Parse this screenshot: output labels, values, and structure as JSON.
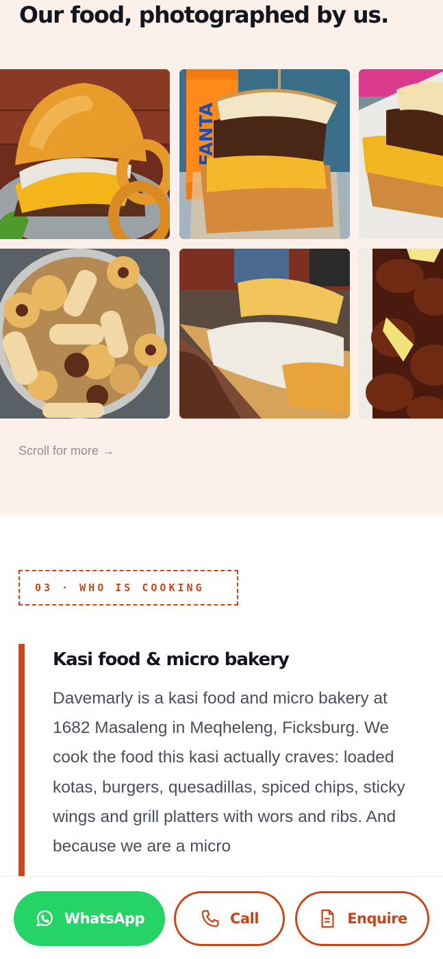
{
  "gallery": {
    "title": "Our food, photographed by us.",
    "scroll_hint": "Scroll for more →",
    "photos": [
      {
        "subject": "loaded burger with onion rings"
      },
      {
        "subject": "stacked kota with Fanta can",
        "can_text": "FANTA"
      },
      {
        "subject": "loaded kota in takeaway box"
      },
      {
        "subject": "bowl of assorted biscuits"
      },
      {
        "subject": "quesadilla platter on wooden board"
      },
      {
        "subject": "sticky wings with lemon wedge"
      }
    ]
  },
  "about": {
    "eyebrow": "03 · WHO IS COOKING",
    "heading": "Kasi food & micro bakery",
    "body": "Davemarly is a kasi food and micro bakery at 1682 Masaleng in Meqheleng, Ficksburg. We cook the food this kasi actually craves: loaded kotas, burgers, quesadillas, spiced chips, sticky wings and grill platters with wors and ribs. And because we are a micro"
  },
  "actions": {
    "whatsapp_label": "WhatsApp",
    "call_label": "Call",
    "enquire_label": "Enquire"
  },
  "colors": {
    "accent": "#cc4416",
    "whatsapp": "#25d366",
    "section_bg": "#fcf1ea",
    "heading": "#14161f"
  },
  "icons": [
    "whatsapp-icon",
    "phone-icon",
    "document-icon"
  ]
}
